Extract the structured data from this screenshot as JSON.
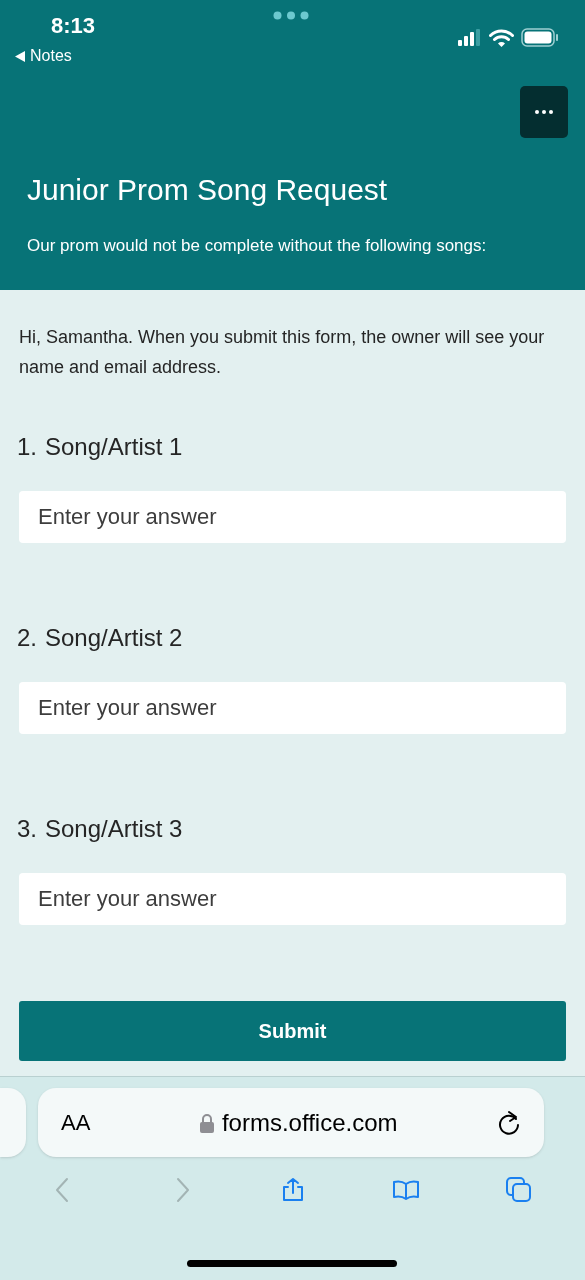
{
  "status_bar": {
    "time": "8:13",
    "back_app": "Notes"
  },
  "header": {
    "title": "Junior Prom Song Request",
    "subtitle": "Our prom would not be complete without the following songs:"
  },
  "intro": "Hi, Samantha. When you submit this form, the owner will see your name and email address.",
  "questions": [
    {
      "number": "1.",
      "label": "Song/Artist 1",
      "placeholder": "Enter your answer"
    },
    {
      "number": "2.",
      "label": "Song/Artist 2",
      "placeholder": "Enter your answer"
    },
    {
      "number": "3.",
      "label": "Song/Artist 3",
      "placeholder": "Enter your answer"
    }
  ],
  "submit": "Submit",
  "browser": {
    "text_size": "AA",
    "url": "forms.office.com",
    "toolbar": [
      {
        "kind": "back",
        "disabled": true
      },
      {
        "kind": "forward",
        "disabled": true
      },
      {
        "kind": "share",
        "disabled": false
      },
      {
        "kind": "bookmarks",
        "disabled": false
      },
      {
        "kind": "tabs",
        "disabled": false
      }
    ]
  }
}
